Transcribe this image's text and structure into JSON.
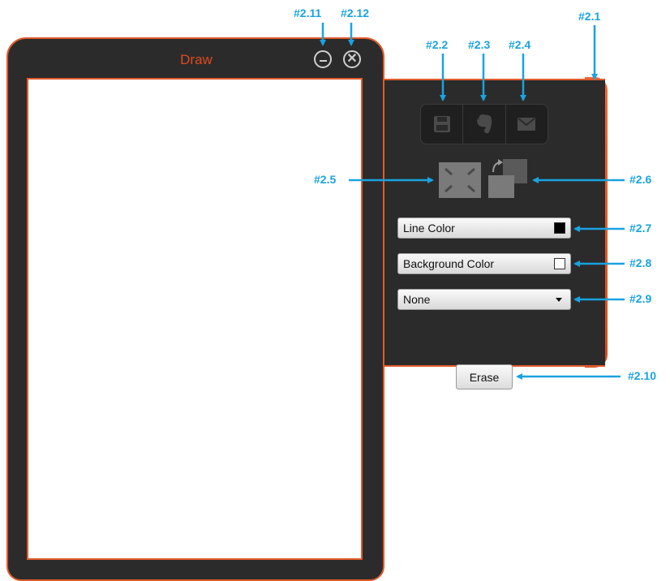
{
  "draw_window": {
    "title": "Draw"
  },
  "panel": {
    "toolbar": {
      "save_icon": "floppy-disk-icon",
      "evernote_icon": "evernote-elephant-icon",
      "email_icon": "envelope-icon"
    },
    "fit_icon": "shrink-to-fit-icon",
    "swap_icon": "swap-layers-icon",
    "line_color": {
      "label": "Line Color",
      "swatch": "#000000"
    },
    "background_color": {
      "label": "Background Color",
      "swatch": "#ffffff"
    },
    "dropdown": {
      "selected": "None"
    },
    "erase_label": "Erase"
  },
  "annotations": {
    "a2_1": "#2.1",
    "a2_2": "#2.2",
    "a2_3": "#2.3",
    "a2_4": "#2.4",
    "a2_5": "#2.5",
    "a2_6": "#2.6",
    "a2_7": "#2.7",
    "a2_8": "#2.8",
    "a2_9": "#2.9",
    "a2_10": "#2.10",
    "a2_11": "#2.11",
    "a2_12": "#2.12"
  },
  "colors": {
    "accent": "#e05a2b",
    "panel_bg": "#2b2b2b",
    "annotation": "#1aa3df"
  }
}
